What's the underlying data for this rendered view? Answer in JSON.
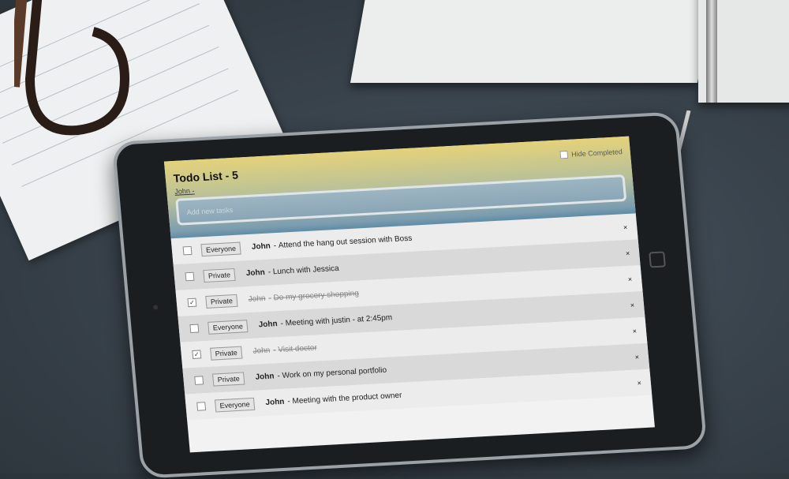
{
  "app": {
    "title": "Todo List - 5",
    "user_link": "John -",
    "hide_completed_label": "Hide Completed",
    "new_task_placeholder": "Add new tasks"
  },
  "tasks": [
    {
      "checked": false,
      "scope": "Everyone",
      "owner": "John",
      "separator": "-",
      "text": "Attend the hang out session with Boss",
      "delete": "×"
    },
    {
      "checked": false,
      "scope": "Private",
      "owner": "John",
      "separator": "-",
      "text": "Lunch with Jessica",
      "delete": "×"
    },
    {
      "checked": true,
      "scope": "Private",
      "owner": "John",
      "separator": "-",
      "text": "Do my grocery shopping",
      "delete": "×"
    },
    {
      "checked": false,
      "scope": "Everyone",
      "owner": "John",
      "separator": "-",
      "text": "Meeting with justin - at 2:45pm",
      "delete": "×"
    },
    {
      "checked": true,
      "scope": "Private",
      "owner": "John",
      "separator": "-",
      "text": "Visit doctor",
      "delete": "×"
    },
    {
      "checked": false,
      "scope": "Private",
      "owner": "John",
      "separator": "-",
      "text": "Work on my personal portfolio",
      "delete": "×"
    },
    {
      "checked": false,
      "scope": "Everyone",
      "owner": "John",
      "separator": "-",
      "text": "Meeting with the product owner",
      "delete": "×"
    }
  ],
  "colors": {
    "header_top": "#e4d27a",
    "header_bottom": "#2f6f94",
    "row_light": "#ececec",
    "row_dark": "#d9d9d9"
  }
}
